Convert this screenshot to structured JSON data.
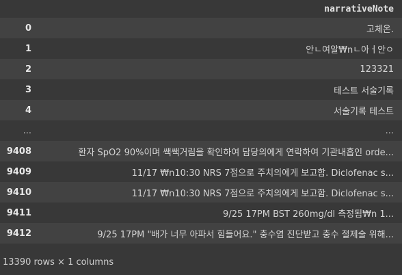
{
  "dataframe": {
    "column_header": "narrativeNote",
    "rows": [
      {
        "index": "0",
        "value": "고체온."
      },
      {
        "index": "1",
        "value": "안ㄴ여알₩nㄴ아ㅓ안ㅇ"
      },
      {
        "index": "2",
        "value": "123321"
      },
      {
        "index": "3",
        "value": "테스트 서술기록"
      },
      {
        "index": "4",
        "value": "서술기록 테스트"
      },
      {
        "index": "...",
        "value": "..."
      },
      {
        "index": "9408",
        "value": "환자 SpO2 90%이며 쌕쌕거림을 확인하여 담당의에게 연락하여 기관내흡인 orde..."
      },
      {
        "index": "9409",
        "value": "11/17 ₩n10:30 NRS 7점으로 주치의에게 보고함. Diclofenac s..."
      },
      {
        "index": "9410",
        "value": "11/17 ₩n10:30 NRS 7점으로 주치의에게 보고함. Diclofenac s..."
      },
      {
        "index": "9411",
        "value": "9/25 17PM BST 260mg/dl 측정됨₩n 1..."
      },
      {
        "index": "9412",
        "value": "9/25 17PM \"배가 너무 아파서 힘들어요.\" 충수염 진단받고 충수 절제술 위해..."
      }
    ],
    "footer": "13390 rows × 1 columns"
  }
}
